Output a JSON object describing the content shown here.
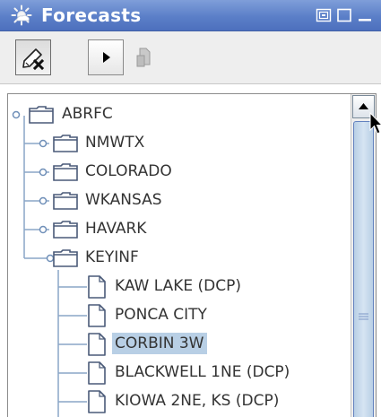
{
  "window": {
    "title": "Forecasts",
    "icon": "forecast-app-icon",
    "controls": [
      "restore-icon",
      "maximize-icon",
      "minimize-icon"
    ]
  },
  "toolbar": {
    "buttons": [
      {
        "icon": "clear-edit-icon",
        "state": "pressed"
      },
      {
        "icon": "play-icon",
        "state": "enabled"
      },
      {
        "icon": "document-icon",
        "state": "disabled"
      }
    ]
  },
  "tree": {
    "root": {
      "label": "ABRFC",
      "expanded": true
    },
    "groups": [
      {
        "label": "NMWTX",
        "expanded": false
      },
      {
        "label": "COLORADO",
        "expanded": false
      },
      {
        "label": "WKANSAS",
        "expanded": false
      },
      {
        "label": "HAVARK",
        "expanded": false
      },
      {
        "label": "KEYINF",
        "expanded": true
      }
    ],
    "leaves": [
      {
        "label": "KAW LAKE (DCP)",
        "selected": false
      },
      {
        "label": "PONCA CITY",
        "selected": false
      },
      {
        "label": "CORBIN 3W",
        "selected": true
      },
      {
        "label": "BLACKWELL 1NE (DCP)",
        "selected": false
      },
      {
        "label": "KIOWA 2NE, KS (DCP)",
        "selected": false
      }
    ]
  },
  "colors": {
    "title_bar": "#5b7fc8",
    "selection": "#b8cfe5",
    "tree_lines": "#8aa5c7",
    "folder": "#4a5a78"
  }
}
